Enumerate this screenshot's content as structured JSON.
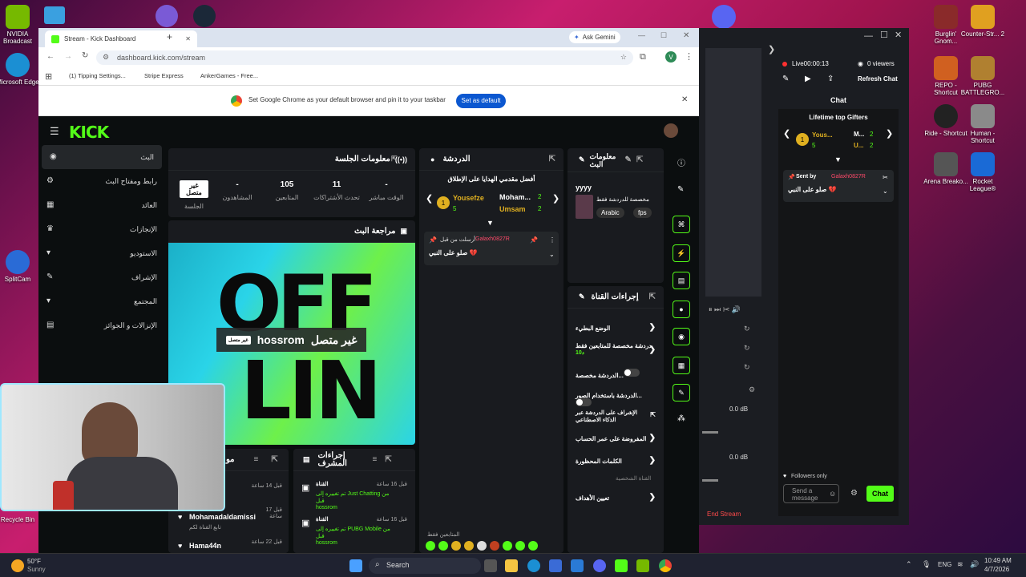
{
  "desktop": {
    "icons_left": [
      {
        "label": "NVIDIA Broadcast",
        "color": "#76b900"
      },
      {
        "label": "Microsoft Edge",
        "color": "#1b8fd3"
      },
      {
        "label": "SplitCam",
        "color": "#2a6bd6"
      },
      {
        "label": "Recycle Bin",
        "color": "#6b7b8b"
      }
    ],
    "icons_right": [
      {
        "label": "Burglin' Gnom...",
        "color": "#8a2a2a"
      },
      {
        "label": "Counter-Str... 2",
        "color": "#e0a020"
      },
      {
        "label": "REPO - Shortcut",
        "color": "#d06020"
      },
      {
        "label": "PUBG BATTLEGRO...",
        "color": "#b08030"
      },
      {
        "label": "Ride - Shortcut",
        "color": "#444"
      },
      {
        "label": "Human - Shortcut",
        "color": "#8a8a8a"
      },
      {
        "label": "Arena Breako...",
        "color": "#555"
      },
      {
        "label": "Rocket League®",
        "color": "#1a6ad6"
      }
    ]
  },
  "browser": {
    "tab_title": "Stream - Kick Dashboard",
    "ask_gemini": "Ask Gemini",
    "url": "dashboard.kick.com/stream",
    "bookmarks": [
      "(1) Tipping Settings...",
      "Stripe Express",
      "AnkerGames - Free..."
    ],
    "infobar_text": "Set Google Chrome as your default browser and pin it to your taskbar",
    "set_default": "Set as default",
    "profile_initial": "V"
  },
  "kick": {
    "logo": "KICK",
    "nav": [
      {
        "label": "البث",
        "icon": "((•))"
      },
      {
        "label": "رابط ومفتاح البث",
        "icon": "⚙"
      },
      {
        "label": "العائد",
        "icon": "▦"
      },
      {
        "label": "الإنجازات",
        "icon": "🏆"
      },
      {
        "label": "الاستوديو",
        "icon": "▾"
      },
      {
        "label": "الإشراف",
        "icon": "✎"
      },
      {
        "label": "المجتمع",
        "icon": "▾"
      },
      {
        "label": "الإنزالات و الجوائز",
        "icon": "▤"
      }
    ],
    "session": {
      "title": "معلومات الجلسة",
      "stats": [
        {
          "value": "-",
          "label": "الوقت مباشر"
        },
        {
          "value": "11",
          "label": "تحدث الأشتراكات"
        },
        {
          "value": "105",
          "label": "المتابعين"
        },
        {
          "value": "-",
          "label": "المشاهدون"
        },
        {
          "value": "غير متصل",
          "label": "الجلسة"
        }
      ]
    },
    "preview": {
      "title": "مراجعة البث",
      "overlay_name": "hossrom",
      "overlay_status": "غير متصل",
      "badge": "غير متصل",
      "big_text_1": "OFF",
      "big_text_2": "LIN"
    },
    "chat": {
      "title": "الدردشة",
      "gifters_title": "أفضل مقدمي الهدايا على الإطلاق",
      "gifter1": "Yousefze",
      "gifter1_count": "5",
      "gifter2": "Moham...",
      "gifter2_count": "2",
      "gifter3": "Umsam",
      "gifter3_count": "2",
      "pinned_by": "أرسلت من قبل",
      "pinned_user": "Galaxh0827R",
      "pinned_message": "صلو على النبي 💔",
      "followers_label": "المتابعين فقط"
    },
    "stream_info": {
      "title": "معلومات البث",
      "stream_title": "yyyy",
      "category": "مخصصة للدردشة فقط",
      "tags": [
        "Arabic",
        "fps"
      ]
    },
    "channel_actions": {
      "title": "إجراءات القناة",
      "items": [
        {
          "label": "الوضع البطيء",
          "control": "chevron"
        },
        {
          "label": "دردشة مخصصة للمتابعين فقط",
          "sub": "10د",
          "control": "chevron"
        },
        {
          "label": "الدردشة مخصصة...",
          "control": "toggle"
        },
        {
          "label": "الدردشة باستخدام الصور...",
          "control": "toggle"
        },
        {
          "label": "الإشراف على الدردشة عبر الذكاء الاصطناعي",
          "control": "external"
        },
        {
          "label": "المفروضة على عمر الحساب",
          "control": "chevron"
        },
        {
          "label": "الكلمات المحظورة",
          "control": "chevron"
        },
        {
          "label": "القناة الشخصية",
          "control": "none"
        },
        {
          "label": "تعيين الأهداف",
          "control": "chevron"
        }
      ]
    },
    "activity": {
      "title": "إجراءات المشرف",
      "entries": [
        {
          "time": "قبل 16 ساعة",
          "who": "القناة",
          "text": "تم تغييره إلى Just Chatting من قبل",
          "user": "hossrom"
        },
        {
          "time": "قبل 16 ساعة",
          "who": "القناة",
          "text": "تم تغييره إلى PUBG Mobile من قبل",
          "user": "hossrom"
        }
      ],
      "left_title": "مو",
      "left_entries": [
        {
          "time": "قبل 14 ساعة",
          "user": ""
        },
        {
          "time": "قبل 17 ساعة",
          "user": "Mohamadaldamissi",
          "sub": "تابع القناة لكم"
        },
        {
          "time": "قبل 22 ساعة",
          "user": "Hama44n"
        }
      ]
    }
  },
  "obs": {
    "live_time": "Live00:00:13",
    "viewers": "0 viewers",
    "refresh": "Refresh Chat",
    "chat_tab": "Chat",
    "gifters_title": "Lifetime top Gifters",
    "gifter1": "Yous...",
    "gifter1_count": "5",
    "gifter2": "M...",
    "gifter2_count": "2",
    "gifter3": "U...",
    "gifter3_count": "2",
    "sent_by": "Sent by",
    "sent_user": "Galaxh0827R",
    "message": "صلو على النبي 💔",
    "followers_only": "Followers only",
    "send_placeholder": "Send a message",
    "chat_button": "Chat",
    "db1": "0.0 dB",
    "db2": "0.0 dB",
    "end_stream": "End Stream"
  },
  "taskbar": {
    "weather_temp": "50°F",
    "weather_desc": "Sunny",
    "search": "Search",
    "lang": "ENG",
    "time": "10:49 AM",
    "date": "4/7/2026"
  }
}
